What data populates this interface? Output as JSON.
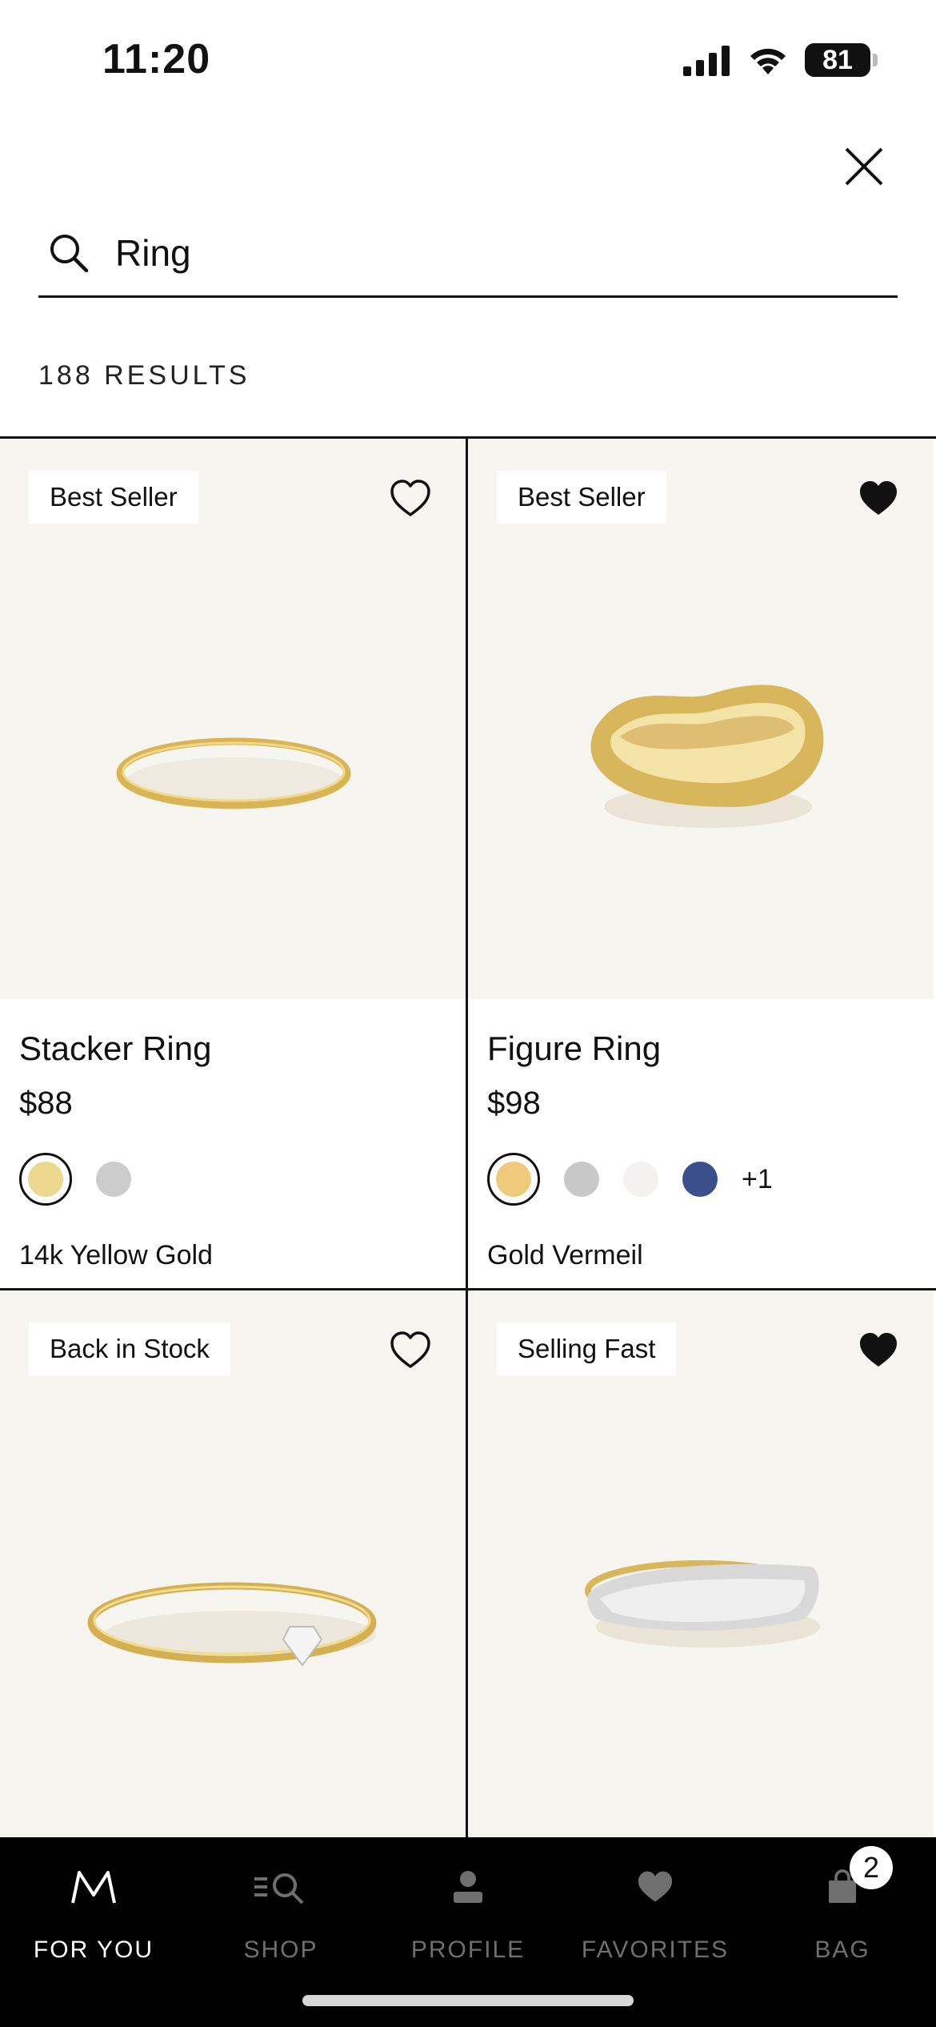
{
  "status_bar": {
    "time": "11:20",
    "battery": "81"
  },
  "search": {
    "query": "Ring",
    "placeholder": ""
  },
  "results": {
    "count_label": "188 RESULTS"
  },
  "products": [
    {
      "badge": "Best Seller",
      "favorited": false,
      "name": "Stacker Ring",
      "price": "$88",
      "swatches": [
        "#ecd88e",
        "#cccccc"
      ],
      "extra_swatches": "",
      "metal": "14k Yellow Gold"
    },
    {
      "badge": "Best Seller",
      "favorited": true,
      "name": "Figure Ring",
      "price": "$98",
      "swatches": [
        "#efc97c",
        "#c8c8c8",
        "#f3f2ee",
        "#3a4f8c"
      ],
      "extra_swatches": "+1",
      "metal": "Gold Vermeil"
    },
    {
      "badge": "Back in Stock",
      "favorited": false,
      "name": "",
      "price": "",
      "swatches": [],
      "extra_swatches": "",
      "metal": ""
    },
    {
      "badge": "Selling Fast",
      "favorited": true,
      "name": "",
      "price": "",
      "swatches": [],
      "extra_swatches": "",
      "metal": ""
    }
  ],
  "tab_bar": {
    "tabs": [
      {
        "label": "FOR YOU",
        "icon": "m-logo-icon",
        "active": true
      },
      {
        "label": "SHOP",
        "icon": "shop-search-icon",
        "active": false
      },
      {
        "label": "PROFILE",
        "icon": "person-icon",
        "active": false
      },
      {
        "label": "FAVORITES",
        "icon": "heart-icon",
        "active": false
      },
      {
        "label": "BAG",
        "icon": "bag-icon",
        "active": false
      }
    ],
    "bag_count": "2"
  }
}
